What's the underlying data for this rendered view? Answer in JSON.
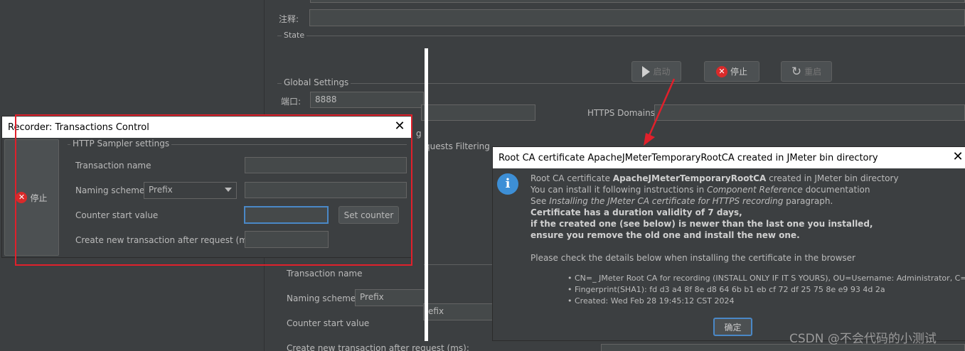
{
  "main": {
    "comment_label": "注释:",
    "state_label": "State",
    "buttons": {
      "start": "启动",
      "stop": "停止",
      "restart": "重启"
    },
    "global_settings": {
      "title": "Global Settings",
      "port_label": "端口:",
      "port_value": "8888",
      "https_domains_label": "HTTPS Domains:",
      "https_domains_value": ""
    },
    "clipped_tab": "g",
    "clipped_requests_filtering": "quests Filtering",
    "bg_transaction_name_label": "Transaction name",
    "bg_naming_scheme_label": "Naming scheme",
    "bg_naming_scheme_value": "Prefix",
    "bg_prefix_field": "efix",
    "bg_counter_start_label": "Counter start value",
    "bg_create_new_label": "Create new transaction after request (ms):"
  },
  "recorder": {
    "title": "Recorder: Transactions Control",
    "stop_button": "停止",
    "group_title": "HTTP Sampler settings",
    "transaction_name_label": "Transaction name",
    "transaction_name_value": "",
    "naming_scheme_label": "Naming scheme",
    "naming_scheme_value": "Prefix",
    "naming_scheme_text": "",
    "counter_start_label": "Counter start value",
    "counter_start_value": "",
    "set_counter_button": "Set counter",
    "create_new_label": "Create new transaction after request (ms):",
    "create_new_value": ""
  },
  "cert_dialog": {
    "title": "Root CA certificate ApacheJMeterTemporaryRootCA created in JMeter bin directory",
    "line1_prefix": "Root CA certificate ",
    "line1_bold": "ApacheJMeterTemporaryRootCA",
    "line1_suffix": " created in JMeter bin directory",
    "line2_prefix": "You can install it following instructions in ",
    "line2_italic": "Component Reference",
    "line2_suffix": " documentation",
    "line3_prefix": "See ",
    "line3_italic": "Installing the JMeter CA certificate for HTTPS recording",
    "line3_suffix": " paragraph.",
    "line4": "Certificate has a duration validity of 7 days,",
    "line5": "if the created one (see below) is newer than the last one you installed,",
    "line6": "ensure you remove the old one and install the new one.",
    "line7": "Please check the details below when installing the certificate in the browser",
    "bullet1": "• CN=_ JMeter Root CA for recording (INSTALL ONLY IF IT S YOURS), OU=Username: Administrator, C=CN",
    "bullet2": "• Fingerprint(SHA1): fd d3 a4 8f 8e d8 64 6b b1 eb cf 72 df 25 75 8e e9 93 4d 2a",
    "bullet3": "• Created: Wed Feb 28 19:45:12 CST 2024",
    "ok_button": "确定"
  },
  "watermark": "CSDN @不会代码的小测试",
  "colors": {
    "annotation_red": "#e0202b",
    "info_blue": "#3d8fd6",
    "stop_red": "#d92a2a",
    "ok_border": "#4a88c7"
  },
  "icons": [
    "play-icon",
    "stop-icon",
    "restart-icon",
    "close-icon",
    "info-icon",
    "chevron-down-icon"
  ]
}
